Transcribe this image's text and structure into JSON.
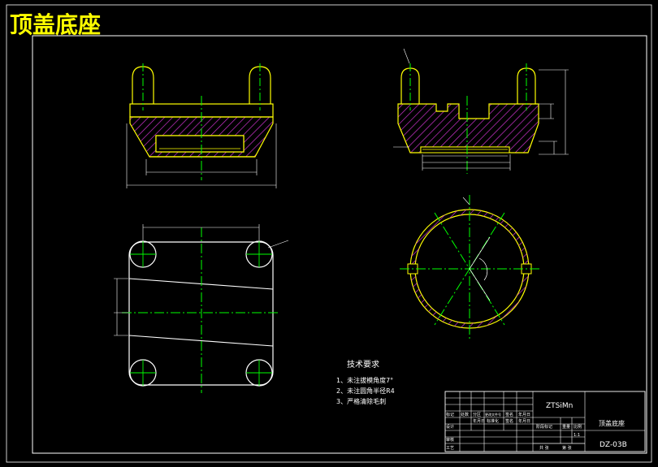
{
  "title": "顶盖底座",
  "colors": {
    "background": "#000000",
    "outline": "#ffffff",
    "part": "#ffff00",
    "centerline": "#00ff00",
    "hatch": "#cc33cc",
    "title_text": "#ffff00"
  },
  "tech": {
    "heading": "技术要求",
    "items": [
      "1、未注拔模角度7°",
      "2、未注圆角半径R4",
      "3、严格清除毛刺"
    ]
  },
  "title_block": {
    "material": "ZTSiMn",
    "part_name": "顶盖底座",
    "drawing_no": "DZ-03B",
    "scale": "1:1",
    "labels": {
      "mark": "标记",
      "count": "处数",
      "zone": "分区",
      "change_doc": "更改文件号",
      "sign": "签名",
      "date": "年月日",
      "design": "设计",
      "standardize": "标准化",
      "stage_mark": "阶段标记",
      "weight": "重量",
      "ratio": "比例",
      "review": "审核",
      "process": "工艺",
      "sheet_total": "共 张",
      "sheet_no": "第 张"
    }
  }
}
